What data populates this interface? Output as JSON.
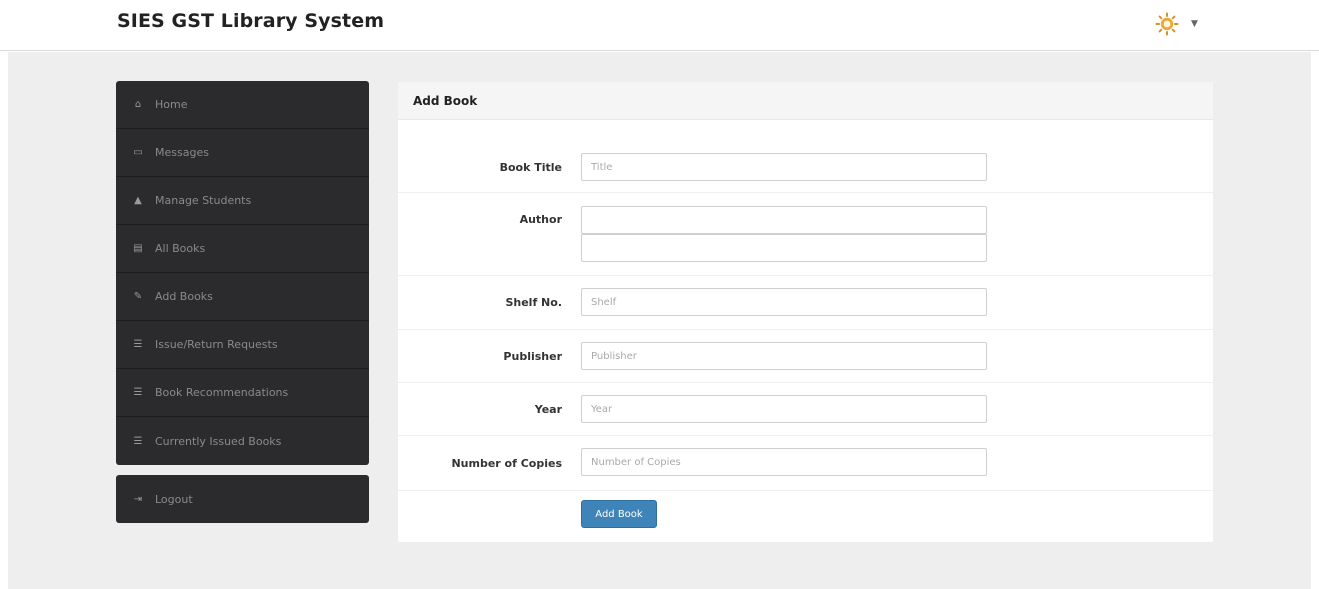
{
  "header": {
    "brand": "SIES GST Library System",
    "user_menu_icon": "sun-avatar-icon",
    "caret_icon": "caret-down-icon"
  },
  "sidebar": {
    "items": [
      {
        "label": "Home",
        "icon": "home-icon",
        "glyph": "⌂"
      },
      {
        "label": "Messages",
        "icon": "inbox-icon",
        "glyph": "▭"
      },
      {
        "label": "Manage Students",
        "icon": "user-icon",
        "glyph": "▲"
      },
      {
        "label": "All Books",
        "icon": "book-icon",
        "glyph": "▤"
      },
      {
        "label": "Add Books",
        "icon": "edit-icon",
        "glyph": "✎"
      },
      {
        "label": "Issue/Return Requests",
        "icon": "list-icon",
        "glyph": "☰"
      },
      {
        "label": "Book Recommendations",
        "icon": "list-icon",
        "glyph": "☰"
      },
      {
        "label": "Currently Issued Books",
        "icon": "list-icon",
        "glyph": "☰"
      }
    ],
    "logout": {
      "label": "Logout",
      "icon": "sign-out-icon",
      "glyph": "⇥"
    }
  },
  "panel": {
    "title": "Add Book",
    "fields": {
      "book_title": {
        "label": "Book Title",
        "placeholder": "Title",
        "value": ""
      },
      "author": {
        "label": "Author",
        "placeholder": "",
        "value": "",
        "value2": ""
      },
      "shelf": {
        "label": "Shelf No.",
        "placeholder": "Shelf",
        "value": ""
      },
      "publisher": {
        "label": "Publisher",
        "placeholder": "Publisher",
        "value": ""
      },
      "year": {
        "label": "Year",
        "placeholder": "Year",
        "value": ""
      },
      "copies": {
        "label": "Number of Copies",
        "placeholder": "Number of Copies",
        "value": ""
      }
    },
    "submit_label": "Add Book"
  }
}
